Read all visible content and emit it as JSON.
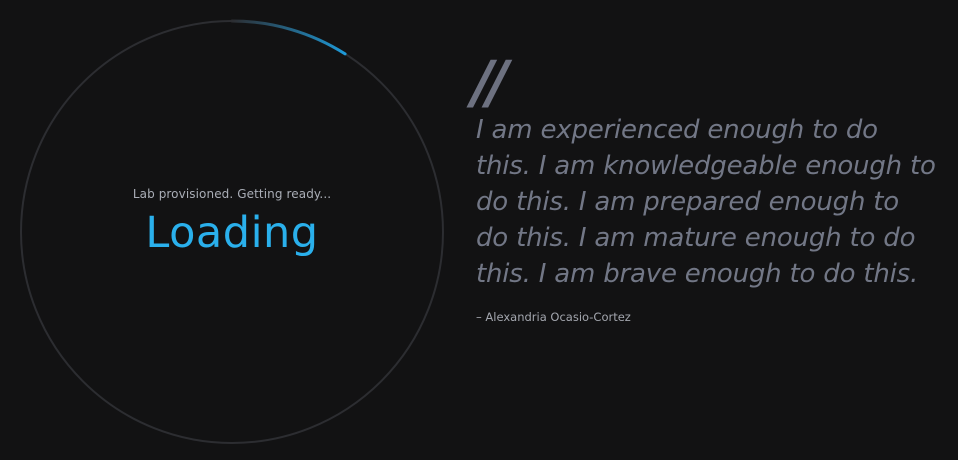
{
  "loader": {
    "status_text": "Lab provisioned. Getting ready...",
    "title": "Loading",
    "progress": 0.09,
    "track_color": "#2c2d31",
    "progress_color": "#1e9ad8",
    "title_color": "#2ab0ec"
  },
  "quote": {
    "mark": "//",
    "text": "I am experienced enough to do this. I am knowledgeable enough to do this. I am prepared enough to do this. I am mature enough to do this. I am brave enough to do this.",
    "author": "– Alexandria Ocasio-Cortez"
  }
}
